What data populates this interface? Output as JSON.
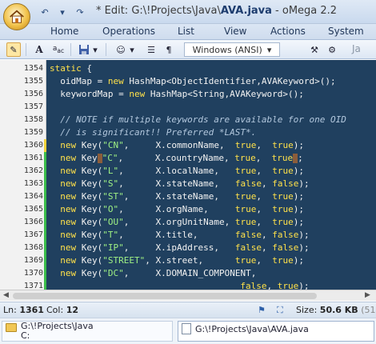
{
  "window": {
    "title_prefix": "* Edit: ",
    "title_path": "G:\\!Projects\\Java\\",
    "title_file": "AVA.java",
    "title_suffix": " - oMega 2.2"
  },
  "ribbon_tabs": [
    "Home",
    "Operations",
    "List",
    "View",
    "Actions",
    "System"
  ],
  "toolbar": {
    "encoding": "Windows (ANSI)",
    "right_text": "Ja"
  },
  "editor": {
    "lines": [
      {
        "n": "1354",
        "mark": "none"
      },
      {
        "n": "1355",
        "mark": "none"
      },
      {
        "n": "1356",
        "mark": "none"
      },
      {
        "n": "1357",
        "mark": "none"
      },
      {
        "n": "1358",
        "mark": "none"
      },
      {
        "n": "1359",
        "mark": "none"
      },
      {
        "n": "1360",
        "mark": "yellow"
      },
      {
        "n": "1361",
        "mark": "green"
      },
      {
        "n": "1362",
        "mark": "green"
      },
      {
        "n": "1363",
        "mark": "green"
      },
      {
        "n": "1364",
        "mark": "green"
      },
      {
        "n": "1365",
        "mark": "green"
      },
      {
        "n": "1366",
        "mark": "green"
      },
      {
        "n": "1367",
        "mark": "green"
      },
      {
        "n": "1368",
        "mark": "green"
      },
      {
        "n": "1369",
        "mark": "green"
      },
      {
        "n": "1370",
        "mark": "green"
      },
      {
        "n": "1371",
        "mark": "green"
      }
    ],
    "code": [
      [
        {
          "t": "static",
          "c": "kw"
        },
        {
          "t": " {",
          "c": ""
        }
      ],
      [
        {
          "t": "  oidMap = ",
          "c": ""
        },
        {
          "t": "new",
          "c": "kw"
        },
        {
          "t": " HashMap<ObjectIdentifier,AVAKeyword>();",
          "c": ""
        }
      ],
      [
        {
          "t": "  keywordMap = ",
          "c": ""
        },
        {
          "t": "new",
          "c": "kw"
        },
        {
          "t": " HashMap<String,AVAKeyword>();",
          "c": ""
        }
      ],
      [
        {
          "t": "",
          "c": ""
        }
      ],
      [
        {
          "t": "  // NOTE if multiple keywords are available for one OID",
          "c": "cm"
        }
      ],
      [
        {
          "t": "  // is significant!! Preferred *LAST*.",
          "c": "cm"
        }
      ],
      [
        {
          "t": "  ",
          "c": ""
        },
        {
          "t": "new",
          "c": "kw"
        },
        {
          "t": " Key(",
          "c": ""
        },
        {
          "t": "\"CN\"",
          "c": "st"
        },
        {
          "t": ",     X.commonName,  ",
          "c": ""
        },
        {
          "t": "true",
          "c": "kw"
        },
        {
          "t": ",  ",
          "c": ""
        },
        {
          "t": "true",
          "c": "kw"
        },
        {
          "t": ");",
          "c": ""
        }
      ],
      [
        {
          "t": "  ",
          "c": ""
        },
        {
          "t": "new",
          "c": "kw"
        },
        {
          "t": " Key",
          "c": ""
        },
        {
          "t": "CURSOR",
          "c": "cur"
        },
        {
          "t": "\"C\"",
          "c": "st"
        },
        {
          "t": ",      X.countryName, ",
          "c": ""
        },
        {
          "t": "true",
          "c": "kw"
        },
        {
          "t": ",  ",
          "c": ""
        },
        {
          "t": "true",
          "c": "kw"
        },
        {
          "t": "CURSOR",
          "c": "cur"
        },
        {
          "t": ";",
          "c": ""
        }
      ],
      [
        {
          "t": "  ",
          "c": ""
        },
        {
          "t": "new",
          "c": "kw"
        },
        {
          "t": " Key(",
          "c": ""
        },
        {
          "t": "\"L\"",
          "c": "st"
        },
        {
          "t": ",      X.localName,   ",
          "c": ""
        },
        {
          "t": "true",
          "c": "kw"
        },
        {
          "t": ",  ",
          "c": ""
        },
        {
          "t": "true",
          "c": "kw"
        },
        {
          "t": ");",
          "c": ""
        }
      ],
      [
        {
          "t": "  ",
          "c": ""
        },
        {
          "t": "new",
          "c": "kw"
        },
        {
          "t": " Key(",
          "c": ""
        },
        {
          "t": "\"S\"",
          "c": "st"
        },
        {
          "t": ",      X.stateName,   ",
          "c": ""
        },
        {
          "t": "false",
          "c": "kw"
        },
        {
          "t": ", ",
          "c": ""
        },
        {
          "t": "false",
          "c": "kw"
        },
        {
          "t": ");",
          "c": ""
        }
      ],
      [
        {
          "t": "  ",
          "c": ""
        },
        {
          "t": "new",
          "c": "kw"
        },
        {
          "t": " Key(",
          "c": ""
        },
        {
          "t": "\"ST\"",
          "c": "st"
        },
        {
          "t": ",     X.stateName,   ",
          "c": ""
        },
        {
          "t": "true",
          "c": "kw"
        },
        {
          "t": ",  ",
          "c": ""
        },
        {
          "t": "true",
          "c": "kw"
        },
        {
          "t": ");",
          "c": ""
        }
      ],
      [
        {
          "t": "  ",
          "c": ""
        },
        {
          "t": "new",
          "c": "kw"
        },
        {
          "t": " Key(",
          "c": ""
        },
        {
          "t": "\"O\"",
          "c": "st"
        },
        {
          "t": ",      X.orgName,     ",
          "c": ""
        },
        {
          "t": "true",
          "c": "kw"
        },
        {
          "t": ",  ",
          "c": ""
        },
        {
          "t": "true",
          "c": "kw"
        },
        {
          "t": ");",
          "c": ""
        }
      ],
      [
        {
          "t": "  ",
          "c": ""
        },
        {
          "t": "new",
          "c": "kw"
        },
        {
          "t": " Key(",
          "c": ""
        },
        {
          "t": "\"OU\"",
          "c": "st"
        },
        {
          "t": ",     X.orgUnitName, ",
          "c": ""
        },
        {
          "t": "true",
          "c": "kw"
        },
        {
          "t": ",  ",
          "c": ""
        },
        {
          "t": "true",
          "c": "kw"
        },
        {
          "t": ");",
          "c": ""
        }
      ],
      [
        {
          "t": "  ",
          "c": ""
        },
        {
          "t": "new",
          "c": "kw"
        },
        {
          "t": " Key(",
          "c": ""
        },
        {
          "t": "\"T\"",
          "c": "st"
        },
        {
          "t": ",      X.title,       ",
          "c": ""
        },
        {
          "t": "false",
          "c": "kw"
        },
        {
          "t": ", ",
          "c": ""
        },
        {
          "t": "false",
          "c": "kw"
        },
        {
          "t": ");",
          "c": ""
        }
      ],
      [
        {
          "t": "  ",
          "c": ""
        },
        {
          "t": "new",
          "c": "kw"
        },
        {
          "t": " Key(",
          "c": ""
        },
        {
          "t": "\"IP\"",
          "c": "st"
        },
        {
          "t": ",     X.ipAddress,   ",
          "c": ""
        },
        {
          "t": "false",
          "c": "kw"
        },
        {
          "t": ", ",
          "c": ""
        },
        {
          "t": "false",
          "c": "kw"
        },
        {
          "t": ");",
          "c": ""
        }
      ],
      [
        {
          "t": "  ",
          "c": ""
        },
        {
          "t": "new",
          "c": "kw"
        },
        {
          "t": " Key(",
          "c": ""
        },
        {
          "t": "\"STREET\"",
          "c": "st"
        },
        {
          "t": ", X.street,      ",
          "c": ""
        },
        {
          "t": "true",
          "c": "kw"
        },
        {
          "t": ",  ",
          "c": ""
        },
        {
          "t": "true",
          "c": "kw"
        },
        {
          "t": ");",
          "c": ""
        }
      ],
      [
        {
          "t": "  ",
          "c": ""
        },
        {
          "t": "new",
          "c": "kw"
        },
        {
          "t": " Key(",
          "c": ""
        },
        {
          "t": "\"DC\"",
          "c": "st"
        },
        {
          "t": ",     X.DOMAIN_COMPONENT,",
          "c": ""
        }
      ],
      [
        {
          "t": "                                    ",
          "c": ""
        },
        {
          "t": "false",
          "c": "kw"
        },
        {
          "t": ", ",
          "c": ""
        },
        {
          "t": "true",
          "c": "kw"
        },
        {
          "t": ");",
          "c": ""
        }
      ]
    ]
  },
  "status": {
    "ln_label": "Ln:",
    "ln_value": "1361",
    "col_label": "Col:",
    "col_value": "12",
    "size_label": "Size:",
    "size_value": "50.6 KB",
    "size_extra": "(51"
  },
  "docs": [
    {
      "line1": "G:\\!Projects\\Java",
      "line2": "C:",
      "icon": "folder-icon"
    },
    {
      "line1": "G:\\!Projects\\Java\\AVA.java",
      "icon": "java-file-icon"
    }
  ]
}
